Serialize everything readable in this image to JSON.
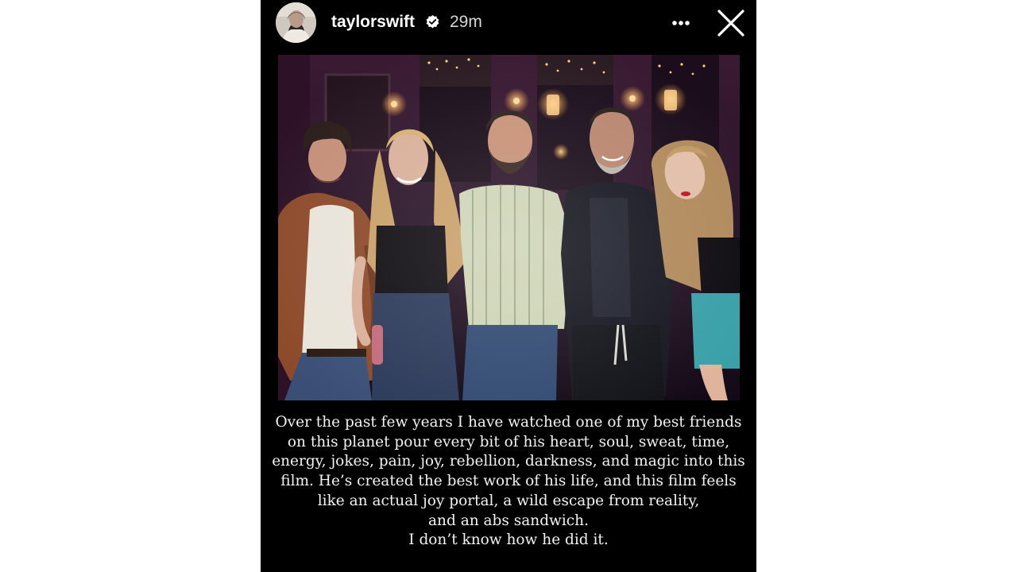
{
  "story": {
    "username": "taylorswift",
    "verified_icon": "verified-badge-icon",
    "timestamp": "29m",
    "more_icon": "more-horizontal-icon",
    "close_icon": "close-icon",
    "caption_lines": [
      "Over the past few years I have watched one of my best friends",
      "on this planet pour every bit of his heart, soul, sweat, time,",
      "energy, jokes, pain, joy, rebellion, darkness, and magic into this",
      "film. He’s created the best work of his life, and this film feels",
      "like an actual joy portal, a wild escape from reality,",
      "and an abs sandwich.",
      "I don’t know how he did it."
    ]
  },
  "colors": {
    "background": "#ffffff",
    "story_background": "#000000",
    "text": "#ffffff",
    "timestamp": "#d7d7d7"
  }
}
